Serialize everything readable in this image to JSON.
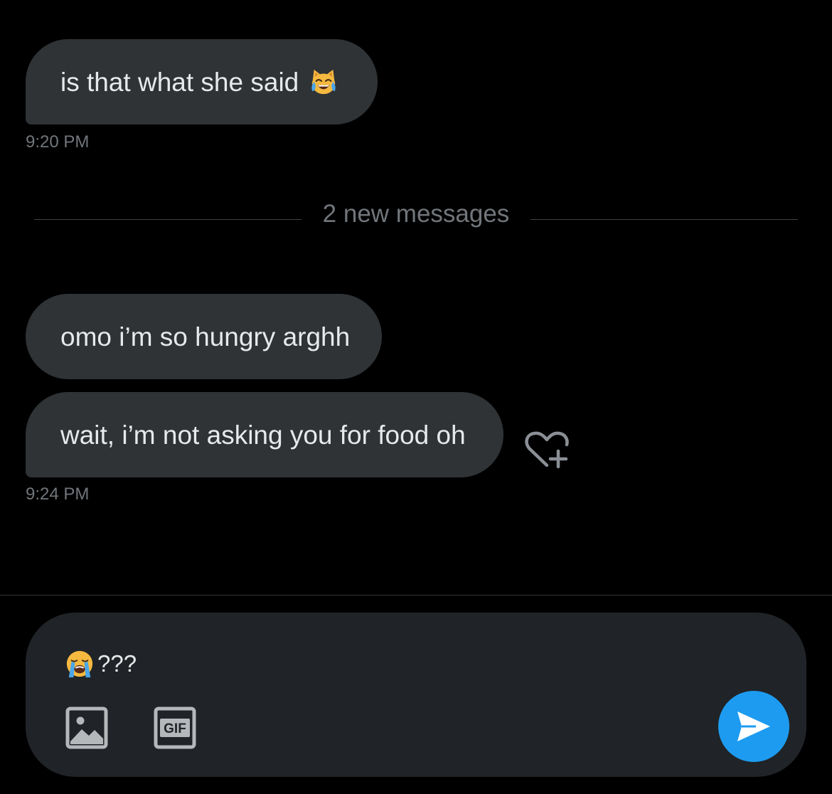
{
  "conversation": {
    "messages": [
      {
        "text": "is that what she said",
        "emoji": "cat-face-with-tears-of-joy"
      },
      {
        "text": "omo i’m so hungry arghh"
      },
      {
        "text": "wait, i’m not asking you for food oh"
      }
    ],
    "timestamps": [
      "9:20 PM",
      "9:24 PM"
    ],
    "divider_label": "2 new messages",
    "reaction_icon": "heart-plus-icon"
  },
  "composer": {
    "value_emoji": "loudly-crying-face",
    "value_text": "???",
    "media_icon": "image-icon",
    "gif_label": "GIF",
    "send_icon": "send-icon"
  },
  "colors": {
    "background": "#000000",
    "bubble": "#2f3336",
    "composer": "#202327",
    "muted_text": "#71767b",
    "primary_text": "#e7e9ea",
    "accent": "#1d9bf0"
  }
}
